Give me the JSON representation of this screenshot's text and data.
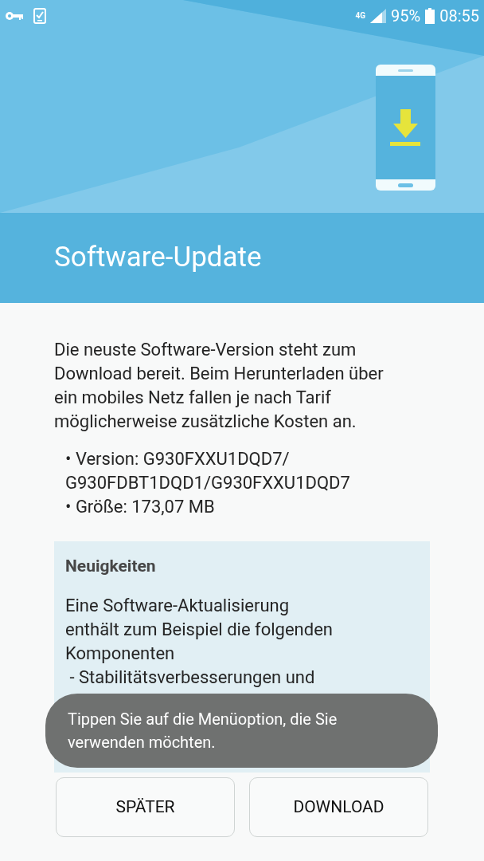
{
  "status_bar": {
    "network": "4G",
    "battery": "95%",
    "time": "08:55"
  },
  "title": "Software-Update",
  "description": "Die neuste Software-Version steht zum Download bereit. Beim Herunterladen über ein mobiles Netz fallen je nach Tarif möglicherweise zusätzliche Kosten an.",
  "details": [
    "• Version: G930FXXU1DQD7/ G930FDBT1DQD1/G930FXXU1DQD7",
    "• Größe: 173,07 MB"
  ],
  "news": {
    "heading": "Neuigkeiten",
    "lines": [
      "Eine Software-Aktualisierung",
      "enthält zum Beispiel die folgenden",
      "Komponenten",
      " - Stabilitätsverbesserungen und"
    ]
  },
  "toast": "Tippen Sie auf die Menüoption, die Sie verwenden möchten.",
  "buttons": [
    "SPÄTER",
    "DOWNLOAD"
  ]
}
